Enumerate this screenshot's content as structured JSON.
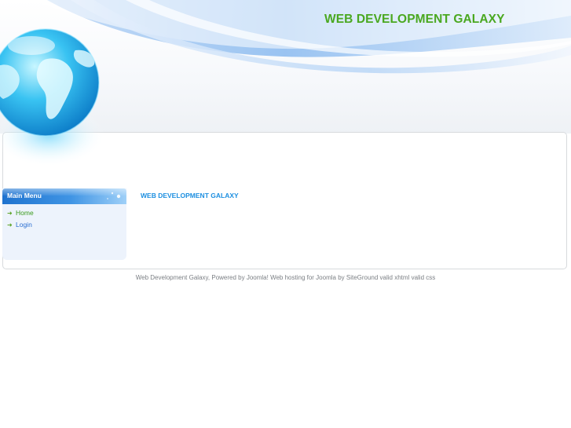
{
  "header": {
    "site_title": "WEB DEVELOPMENT GALAXY"
  },
  "sidebar": {
    "menu_title": "Main Menu",
    "items": [
      {
        "label": "Home",
        "active": true
      },
      {
        "label": "Login",
        "active": false
      }
    ]
  },
  "content": {
    "title": "WEB DEVELOPMENT GALAXY"
  },
  "footer": {
    "text": "Web Development Galaxy, Powered by Joomla! Web hosting for Joomla by SiteGround valid xhtml valid css"
  },
  "colors": {
    "title_green": "#4aa820",
    "link_blue": "#2b6fd1",
    "menu_header_blue": "#1f73cf",
    "sidebar_bg": "#edf3fc"
  }
}
